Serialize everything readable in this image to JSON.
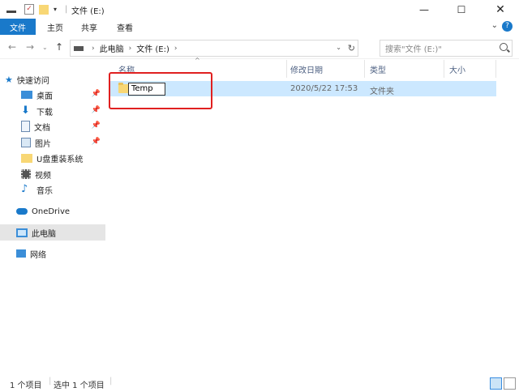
{
  "window": {
    "title": "文件 (E:)"
  },
  "ribbon": {
    "tabs": [
      "文件",
      "主页",
      "共享",
      "查看"
    ],
    "help": "?"
  },
  "address": {
    "crumbs": [
      "此电脑",
      "文件 (E:)"
    ],
    "search_placeholder": "搜索\"文件 (E:)\""
  },
  "sidebar": {
    "quick_access": "快速访问",
    "items": [
      {
        "label": "桌面",
        "icon": "desktop-icon",
        "pinned": true
      },
      {
        "label": "下载",
        "icon": "download-icon",
        "pinned": true
      },
      {
        "label": "文档",
        "icon": "document-icon",
        "pinned": true
      },
      {
        "label": "图片",
        "icon": "picture-icon",
        "pinned": true
      },
      {
        "label": "U盘重装系统",
        "icon": "folder-icon",
        "pinned": false
      },
      {
        "label": "视频",
        "icon": "video-icon",
        "pinned": false
      },
      {
        "label": "音乐",
        "icon": "music-icon",
        "pinned": false
      }
    ],
    "onedrive": "OneDrive",
    "this_pc": "此电脑",
    "network": "网络"
  },
  "columns": {
    "name": "名称",
    "modified": "修改日期",
    "type": "类型",
    "size": "大小"
  },
  "files": [
    {
      "name": "Temp",
      "modified": "2020/5/22 17:53",
      "type": "文件夹",
      "size": ""
    }
  ],
  "status": {
    "count": "1 个项目",
    "selected": "选中 1 个项目"
  },
  "colors": {
    "accent": "#1979ca",
    "selection": "#cce8ff",
    "highlight": "#e02020"
  }
}
